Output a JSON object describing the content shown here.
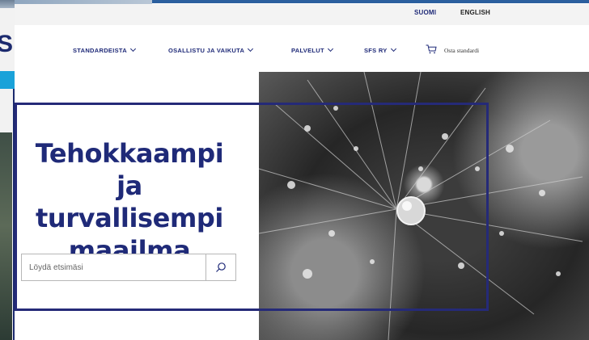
{
  "lang_bar": {
    "finnish": "SUOMI",
    "english": "ENGLISH"
  },
  "nav": {
    "items": [
      {
        "label": "STANDARDEISTA"
      },
      {
        "label": "OSALLISTU JA VAIKUTA"
      },
      {
        "label": "PALVELUT"
      },
      {
        "label": "SFS RY"
      }
    ],
    "cart_label": "Osta standardi"
  },
  "hero": {
    "headline": "Tehokkaampi ja turvallisempi maailma",
    "search_placeholder": "Löydä etsimäsi"
  },
  "icons": {
    "cart": "cart-icon",
    "search": "search-icon",
    "chevron": "chevron-down-icon"
  },
  "colors": {
    "brand": "#1f2a78",
    "frame": "#252a78",
    "accent": "#1aa2d9"
  }
}
